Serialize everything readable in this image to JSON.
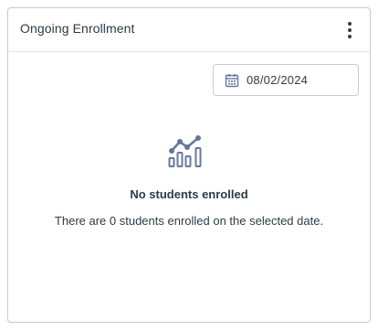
{
  "card": {
    "title": "Ongoing Enrollment",
    "menu_icon": "kebab-menu-icon"
  },
  "date_filter": {
    "icon": "calendar-icon",
    "value": "08/02/2024"
  },
  "empty_state": {
    "icon": "chart-analytics-icon",
    "title": "No students enrolled",
    "message": "There are 0 students enrolled on the selected date."
  },
  "colors": {
    "text": "#2d3b45",
    "icon": "#66789a",
    "border": "#c7cdd1"
  }
}
